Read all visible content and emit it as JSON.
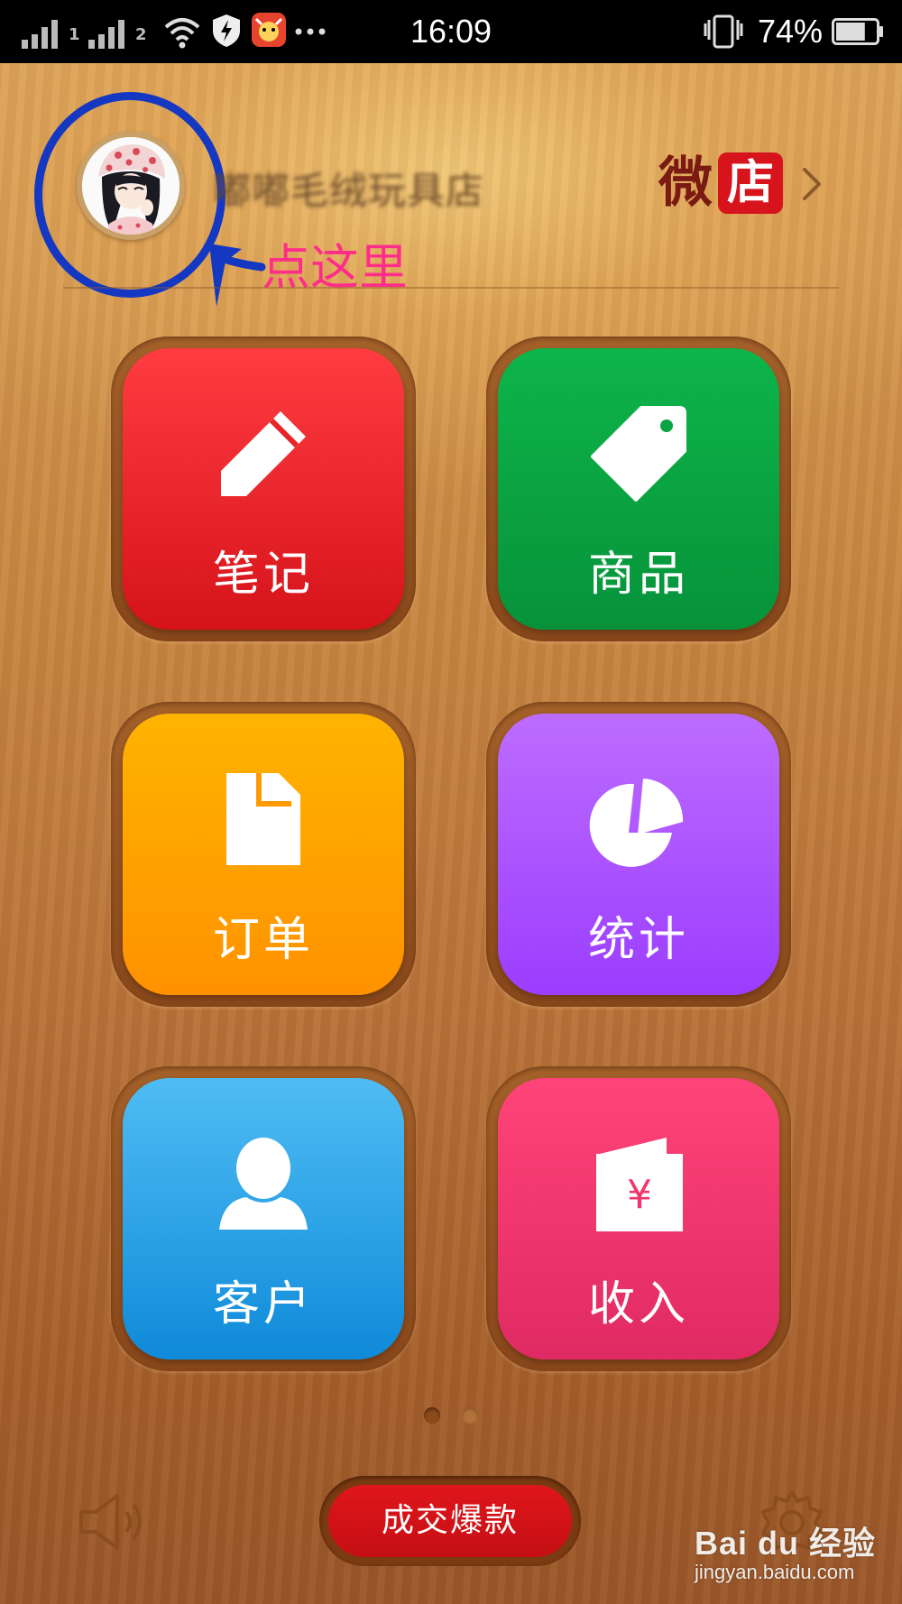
{
  "status_bar": {
    "sim1": "1",
    "sim2": "2",
    "time": "16:09",
    "battery_percent": "74%",
    "battery_level": 0.74,
    "icons": [
      "signal-icon",
      "wifi-icon",
      "shield-icon",
      "app-notification-icon",
      "more-dots-icon",
      "vibrate-icon",
      "battery-icon"
    ]
  },
  "header": {
    "shop_name": "嘟嘟毛绒玩具店",
    "brand_part1": "微",
    "brand_part2": "店",
    "annotation": "点这里"
  },
  "tiles": [
    {
      "label": "笔记",
      "icon": "pencil-icon",
      "color": "#e82428"
    },
    {
      "label": "商品",
      "icon": "tag-icon",
      "color": "#0aa344"
    },
    {
      "label": "订单",
      "icon": "document-icon",
      "color": "#ffa200"
    },
    {
      "label": "统计",
      "icon": "pie-chart-icon",
      "color": "#a851ff"
    },
    {
      "label": "客户",
      "icon": "user-icon",
      "color": "#2aa3e6"
    },
    {
      "label": "收入",
      "icon": "wallet-icon",
      "color": "#f0366d"
    }
  ],
  "pager": {
    "pages": 2,
    "current": 1
  },
  "bottom": {
    "cta_label": "成交爆款"
  },
  "watermark": {
    "logo": "Bai du 经验",
    "url": "jingyan.baidu.com"
  },
  "colors": {
    "annotation_blue": "#1538c2",
    "annotation_pink": "#ff2d8a",
    "brand_red": "#d7141c"
  }
}
